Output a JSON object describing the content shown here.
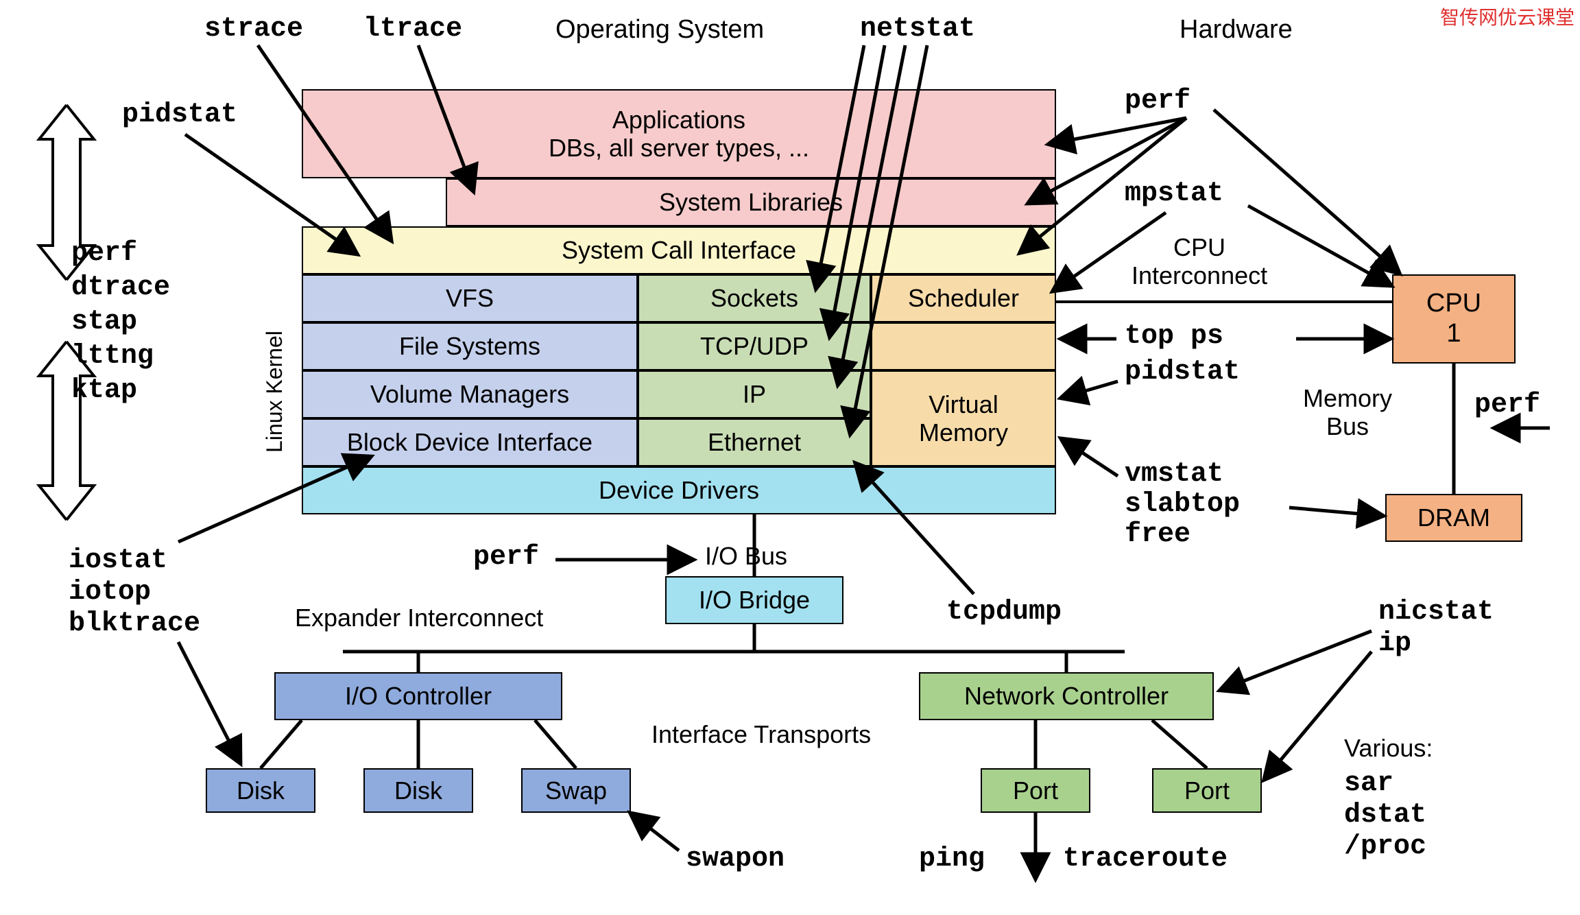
{
  "watermark": "智传网优云课堂",
  "headers": {
    "operating_system": "Operating System",
    "hardware": "Hardware"
  },
  "os_stack": {
    "applications": "Applications\nDBs, all server types, ...",
    "system_libraries": "System Libraries",
    "system_call_interface": "System Call Interface",
    "left_col": [
      "VFS",
      "File Systems",
      "Volume Managers",
      "Block Device Interface"
    ],
    "mid_col": [
      "Sockets",
      "TCP/UDP",
      "IP",
      "Ethernet"
    ],
    "right_col": [
      "Scheduler",
      "",
      "Virtual\nMemory"
    ],
    "device_drivers": "Device Drivers",
    "linux_kernel": "Linux Kernel"
  },
  "hw": {
    "cpu_interconnect": "CPU\nInterconnect",
    "cpu": "CPU\n1",
    "memory_bus": "Memory\nBus",
    "dram": "DRAM",
    "io_bus": "I/O Bus",
    "io_bridge": "I/O Bridge",
    "expander_interconnect": "Expander Interconnect",
    "io_controller": "I/O Controller",
    "network_controller": "Network Controller",
    "interface_transports": "Interface Transports",
    "disk": "Disk",
    "swap": "Swap",
    "port": "Port"
  },
  "tools": {
    "left_tracers": "perf\ndtrace\nstap\nlttng\nktap",
    "strace": "strace",
    "ltrace": "ltrace",
    "netstat": "netstat",
    "pidstat": "pidstat",
    "perf_top": "perf",
    "mpstat": "mpstat",
    "top_ps": "top ps",
    "pidstat2": "pidstat",
    "vmstat_slabtop_free": "vmstat\nslabtop\nfree",
    "perf_mem": "perf",
    "iostat_iotop_blktrace": "iostat\niotop\nblktrace",
    "perf_io": "perf",
    "tcpdump": "tcpdump",
    "nicstat_ip": "nicstat\nip",
    "swapon": "swapon",
    "ping": "ping",
    "traceroute": "traceroute",
    "various_header": "Various:",
    "various": "sar\ndstat\n/proc"
  }
}
